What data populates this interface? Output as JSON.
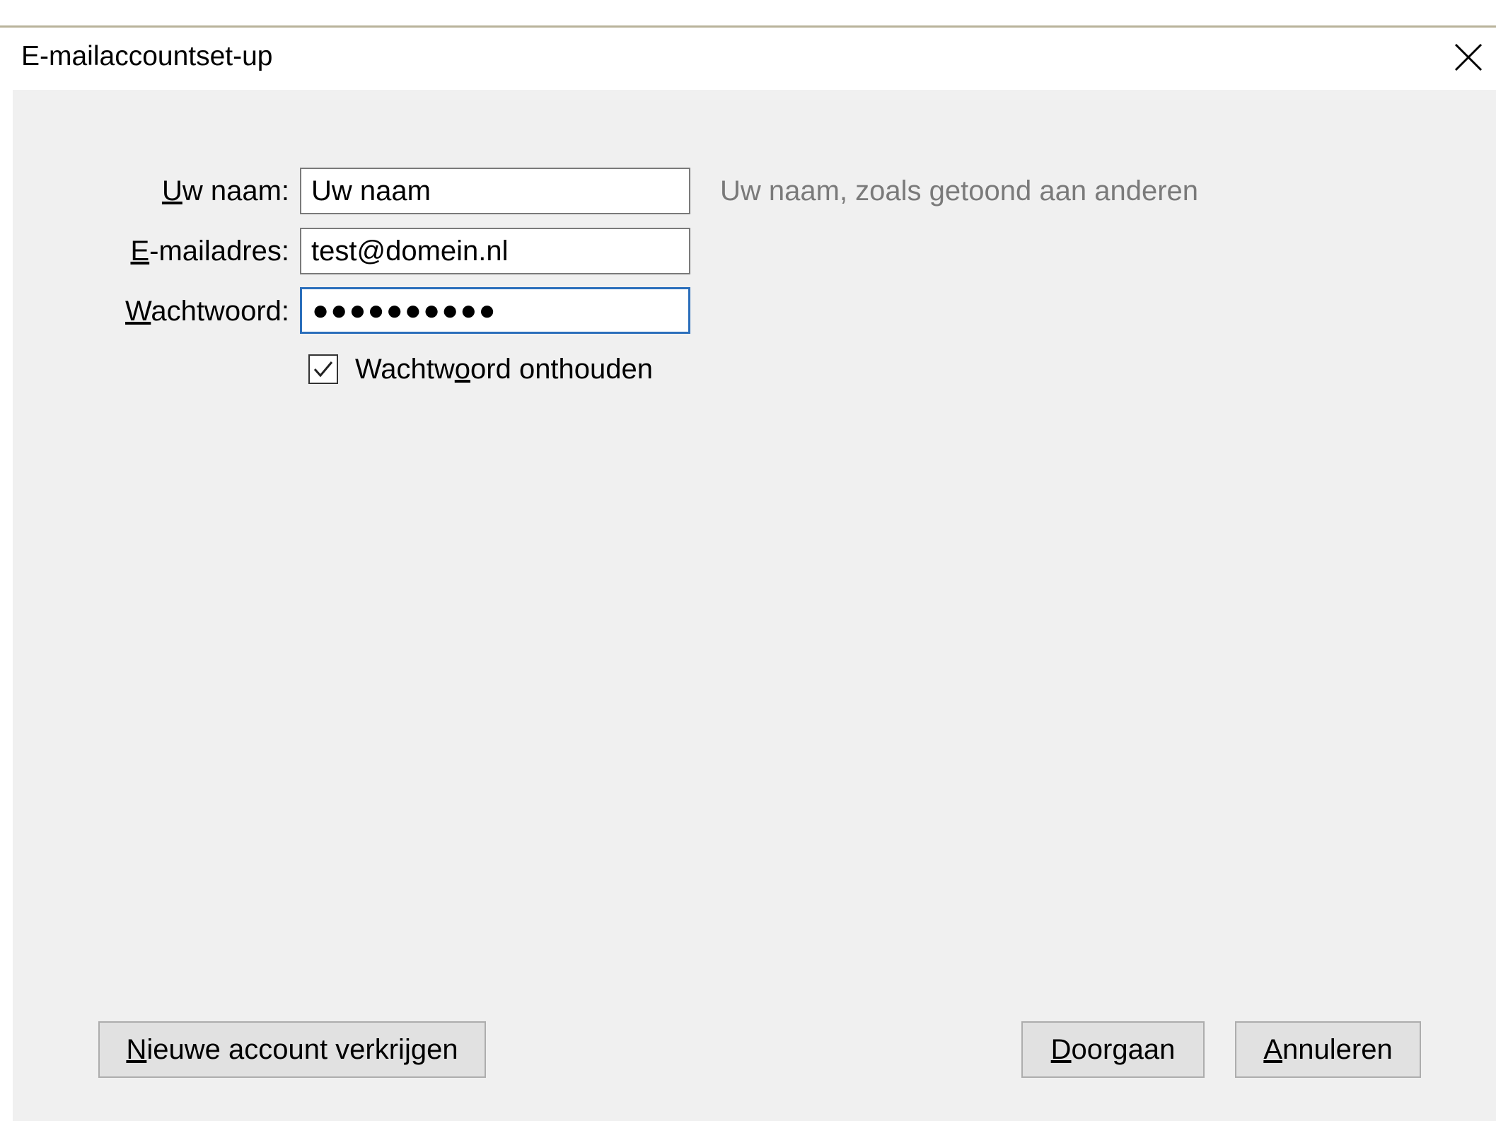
{
  "dialog": {
    "title": "E-mailaccountset-up"
  },
  "form": {
    "name": {
      "label_access": "U",
      "label_rest": "w naam:",
      "value": "Uw naam",
      "hint": "Uw naam, zoals getoond aan anderen"
    },
    "email": {
      "label_access": "E",
      "label_rest": "-mailadres:",
      "value": "test@domein.nl"
    },
    "password": {
      "label_access": "W",
      "label_rest": "achtwoord:",
      "value": "●●●●●●●●●●"
    },
    "remember": {
      "label_pre": "Wachtw",
      "label_access": "o",
      "label_post": "ord onthouden",
      "checked": true
    }
  },
  "buttons": {
    "new_account": {
      "access": "N",
      "rest": "ieuwe account verkrijgen"
    },
    "continue": {
      "access": "D",
      "rest": "oorgaan"
    },
    "cancel": {
      "access": "A",
      "rest": "nnuleren"
    }
  },
  "colors": {
    "focus_border": "#2a6ebb",
    "panel_bg": "#f0f0f0",
    "hint_text": "#7a7a7a"
  }
}
